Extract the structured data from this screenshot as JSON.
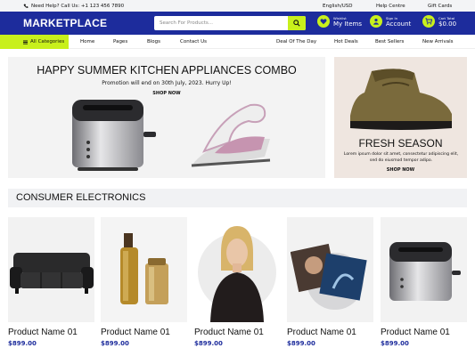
{
  "topbar": {
    "help_text": "Need Help? Call Us: +1 123 456 7890",
    "locale": "English/USD",
    "help_centre": "Help Centre",
    "gift_cards": "Gift Cards"
  },
  "header": {
    "logo": "MARKETPLACE",
    "search_placeholder": "Search For Products...",
    "wishlist_small": "Wishlist",
    "wishlist_big": "My Items",
    "signin_small": "Sign In",
    "signin_big": "Account",
    "cart_small": "Cart Total",
    "cart_big": "$0.00"
  },
  "nav": {
    "categories": "All Categories",
    "links": [
      "Home",
      "Pages",
      "Blogs",
      "Contact Us"
    ],
    "right_links": [
      "Deal Of The Day",
      "Hot Deals",
      "Best Sellers",
      "New Arrivals"
    ]
  },
  "banner_main": {
    "title": "HAPPY SUMMER KITCHEN APPLIANCES COMBO",
    "promo": "Promotion will end on 30th July, 2023. Hurry Up!",
    "cta": "SHOP NOW"
  },
  "banner_side": {
    "title": "FRESH SEASON",
    "desc": "Lorem ipsum dolor sit amet, consectetur adipiscing elit, sed do eiusmod tempor adipo.",
    "cta": "SHOP NOW"
  },
  "section": {
    "title": "CONSUMER ELECTRONICS"
  },
  "products": [
    {
      "name": "Product Name 01",
      "price": "$899.00",
      "icon": "sofa"
    },
    {
      "name": "Product Name 01",
      "price": "$899.00",
      "icon": "perfume"
    },
    {
      "name": "Product Name 01",
      "price": "$899.00",
      "icon": "model"
    },
    {
      "name": "Product Name 01",
      "price": "$899.00",
      "icon": "vinyl-records"
    },
    {
      "name": "Product Name 01",
      "price": "$899.00",
      "icon": "toaster"
    }
  ],
  "colors": {
    "brand": "#1d2c9c",
    "accent": "#c8f01c"
  }
}
